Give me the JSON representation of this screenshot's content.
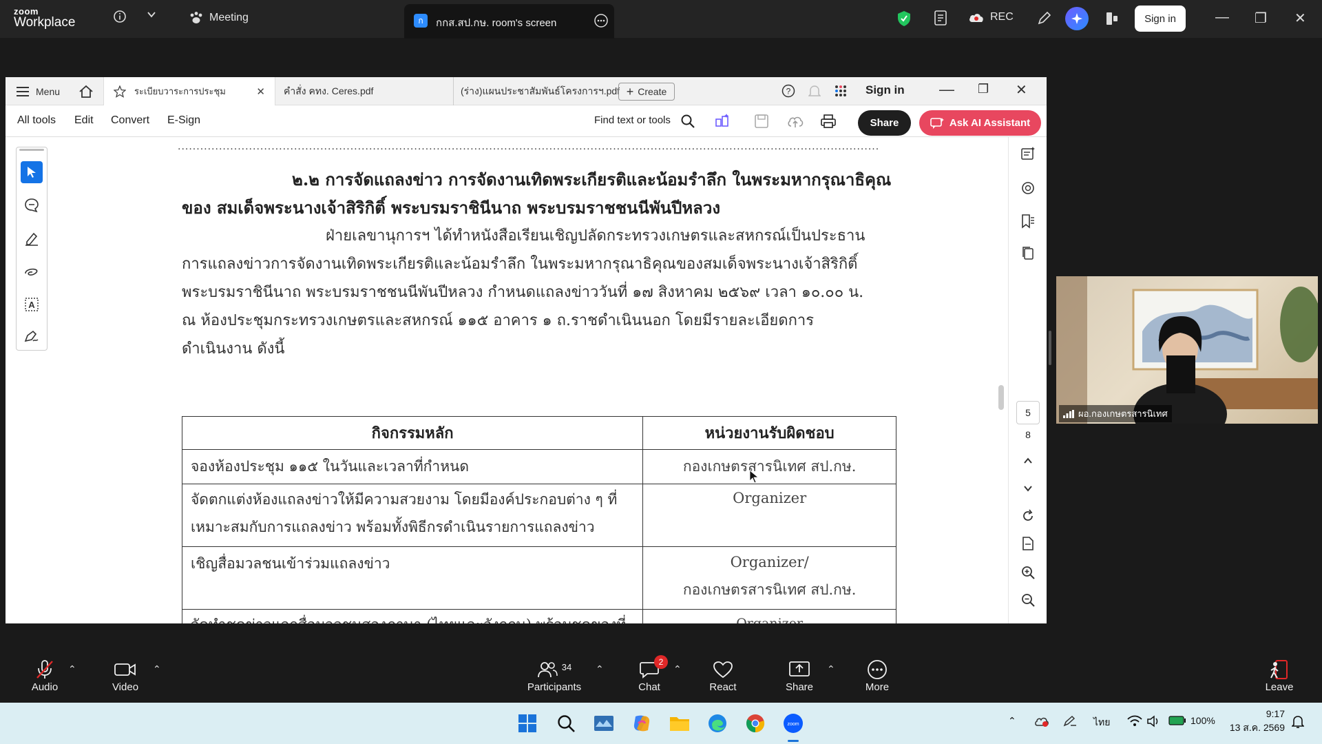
{
  "zoom": {
    "logo_line1": "zoom",
    "logo_line2": "Workplace",
    "meeting_label": "Meeting",
    "shared_screen_tab": "กกส.สป.กษ. room's screen",
    "rec_label": "REC",
    "sign_in": "Sign in"
  },
  "acrobat": {
    "menu_label": "Menu",
    "tabs": [
      {
        "label": "ระเบียบวาระการประชุม"
      },
      {
        "label": "คำสั่ง คทง. Ceres.pdf"
      },
      {
        "label": "(ร่าง)แผนประชาสัมพันธ์โครงการฯ.pdf"
      }
    ],
    "create_label": "Create",
    "sign_in": "Sign in",
    "toolbar": {
      "all_tools": "All tools",
      "edit": "Edit",
      "convert": "Convert",
      "esign": "E-Sign",
      "find": "Find text or tools",
      "share": "Share",
      "ai": "Ask AI Assistant"
    },
    "page_numbers": {
      "current": "5",
      "total": "8"
    }
  },
  "document": {
    "dots": "..................................................................................................................................................................................................................",
    "heading_line1": "๒.๒ การจัดแถลงข่าว การจัดงานเทิดพระเกียรติและน้อมรำลึก ในพระมหากรุณาธิคุณ",
    "heading_line2": "ของ สมเด็จพระนางเจ้าสิริกิติ์ พระบรมราชินีนาถ พระบรมราชชนนีพันปีหลวง",
    "para_lines": [
      "ฝ่ายเลขานุการฯ ได้ทำหนังสือเรียนเชิญปลัดกระทรวงเกษตรและสหกรณ์เป็นประธาน",
      "การแถลงข่าวการจัดงานเทิดพระเกียรติและน้อมรำลึก ในพระมหากรุณาธิคุณของสมเด็จพระนางเจ้าสิริกิติ์",
      "พระบรมราชินีนาถ พระบรมราชชนนีพันปีหลวง กำหนดแถลงข่าววันที่ ๑๗ สิงหาคม ๒๕๖๙  เวลา ๑๐.๐๐ น.",
      "ณ ห้องประชุมกระทรวงเกษตรและสหกรณ์ ๑๑๕ อาคาร ๑ ถ.ราชดำเนินนอก โดยมีรายละเอียดการ",
      "ดำเนินงาน ดังนี้"
    ],
    "table": {
      "headers": [
        "กิจกรรมหลัก",
        "หน่วยงานรับผิดชอบ"
      ],
      "rows": [
        {
          "activity": "จองห้องประชุม ๑๑๕ ในวันและเวลาที่กำหนด",
          "owner": "กองเกษตรสารนิเทศ สป.กษ."
        },
        {
          "activity": "จัดตกแต่งห้องแถลงข่าวให้มีความสวยงาม โดยมีองค์ประกอบต่าง ๆ ที่เหมาะสมกับการแถลงข่าว พร้อมทั้งพิธีกรดำเนินรายการแถลงข่าว",
          "owner": "Organizer"
        },
        {
          "activity": "เชิญสื่อมวลชนเข้าร่วมแถลงข่าว",
          "owner": "Organizer/\nกองเกษตรสารนิเทศ สป.กษ."
        },
        {
          "activity": "จัดทำชุดข่าวแจกสื่อมวลชนสองภาษา (ไทยและอังกฤษ) พร้อมชุดของที่ระลึก ชุดเครื่องดื่มและอาหารว่างสำหรับสื่อมวลชน",
          "owner": "Organizer\n(ตรวจโดยสำนักการเกษตรต่างประเทศ"
        }
      ]
    }
  },
  "video": {
    "participant_name": "ผอ.กองเกษตรสารนิเทศ"
  },
  "controls": {
    "audio": "Audio",
    "video": "Video",
    "participants": "Participants",
    "participants_count": "34",
    "chat": "Chat",
    "chat_badge": "2",
    "react": "React",
    "share": "Share",
    "more": "More",
    "leave": "Leave"
  },
  "taskbar": {
    "lang": "ไทย",
    "battery": "100%",
    "time": "9:17",
    "date": "13 ส.ค. 2569"
  },
  "colors": {
    "zoom_bg": "#242424",
    "ai_button": "#e8475f",
    "accent_blue": "#1473e6"
  }
}
